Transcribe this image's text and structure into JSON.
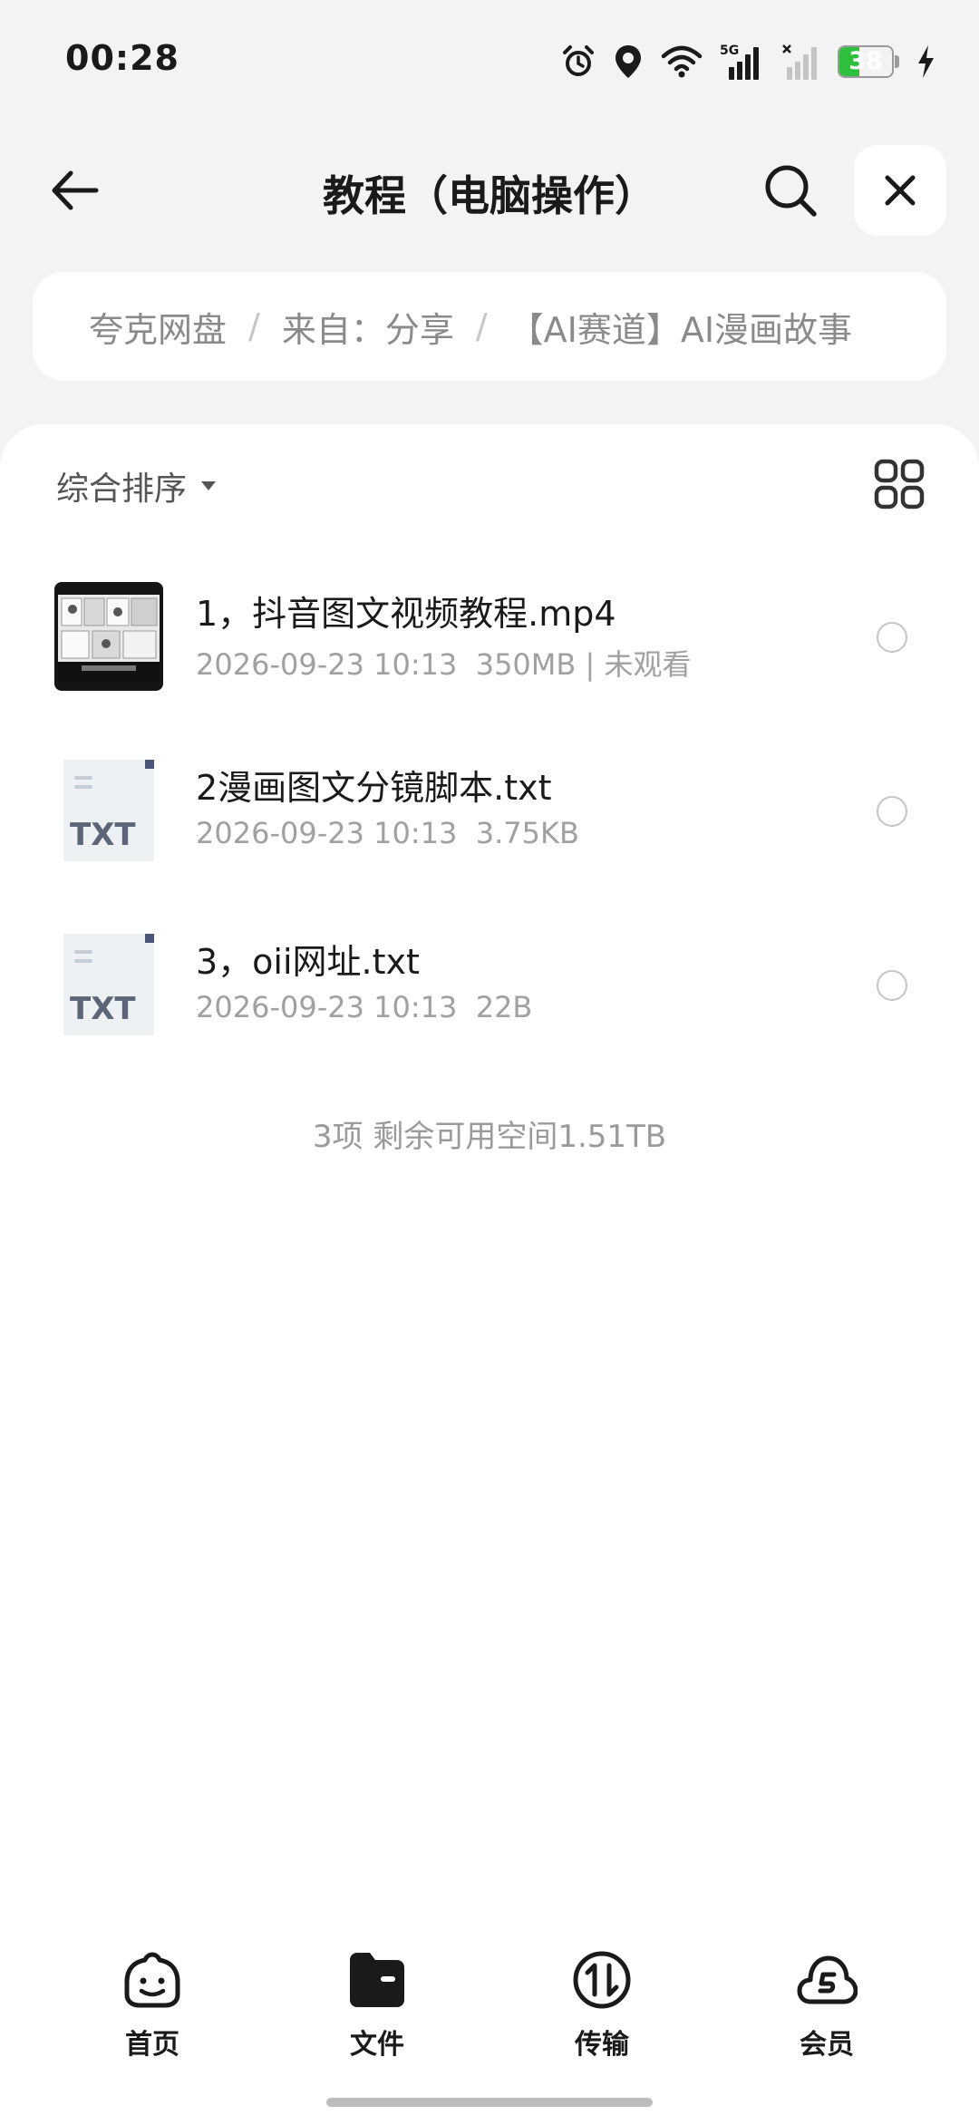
{
  "status_bar": {
    "time": "00:28",
    "network": "5G",
    "battery": "38",
    "battery_level": 0.38
  },
  "header": {
    "title": "教程（电脑操作）"
  },
  "breadcrumb": {
    "items": [
      "夸克网盘",
      "来自：分享",
      "【AI赛道】AI漫画故事"
    ]
  },
  "toolbar": {
    "sort_label": "综合排序"
  },
  "files": [
    {
      "name": "1，抖音图文视频教程.mp4",
      "date": "2026-09-23 10:13",
      "size": "350MB",
      "status": "未观看",
      "type": "video"
    },
    {
      "name": "2漫画图文分镜脚本.txt",
      "date": "2026-09-23 10:13",
      "size": "3.75KB",
      "type": "txt",
      "icon_label": "TXT"
    },
    {
      "name": "3，oii网址.txt",
      "date": "2026-09-23 10:13",
      "size": "22B",
      "type": "txt",
      "icon_label": "TXT"
    }
  ],
  "summary": "3项 剩余可用空间1.51TB",
  "bottom_nav": [
    {
      "label": "首页",
      "icon": "smiley-home-icon"
    },
    {
      "label": "文件",
      "icon": "folder-icon",
      "active": true
    },
    {
      "label": "传输",
      "icon": "transfer-icon"
    },
    {
      "label": "会员",
      "icon": "cloud-member-icon"
    }
  ]
}
